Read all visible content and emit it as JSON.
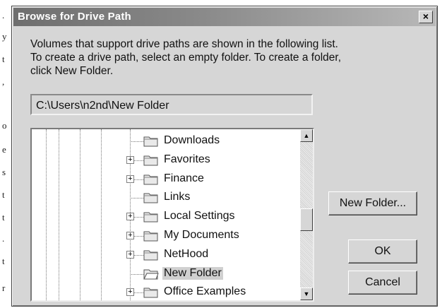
{
  "dialog": {
    "title": "Browse for Drive Path",
    "close_label": "×",
    "description": [
      "Volumes that support drive paths are shown in the following list.",
      "To create a drive path, select an empty folder. To create a folder,",
      "click New Folder."
    ],
    "path_value": "C:\\Users\\n2nd\\New Folder"
  },
  "tree": {
    "items": [
      {
        "label": "Downloads",
        "expandable": false,
        "selected": false
      },
      {
        "label": "Favorites",
        "expandable": true,
        "selected": false
      },
      {
        "label": "Finance",
        "expandable": true,
        "selected": false
      },
      {
        "label": "Links",
        "expandable": false,
        "selected": false
      },
      {
        "label": "Local Settings",
        "expandable": true,
        "selected": false
      },
      {
        "label": "My Documents",
        "expandable": true,
        "selected": false
      },
      {
        "label": "NetHood",
        "expandable": true,
        "selected": false
      },
      {
        "label": "New Folder",
        "expandable": false,
        "selected": true
      },
      {
        "label": "Office Examples",
        "expandable": true,
        "selected": false
      }
    ],
    "expander_symbol": "+"
  },
  "scrollbar": {
    "up_arrow": "▲",
    "down_arrow": "▼"
  },
  "buttons": {
    "new_folder": "New Folder...",
    "ok": "OK",
    "cancel": "Cancel"
  },
  "edge_fragments": [
    ".",
    "y",
    "t",
    ",",
    "o",
    "e",
    "s",
    "t",
    "t",
    ".",
    "t",
    "r"
  ],
  "colors": {
    "dialog_face": "#d6d6d6",
    "title_gradient_start": "#6e6e6e",
    "title_gradient_end": "#b8b8b8",
    "selection": "#d0d0d0"
  }
}
